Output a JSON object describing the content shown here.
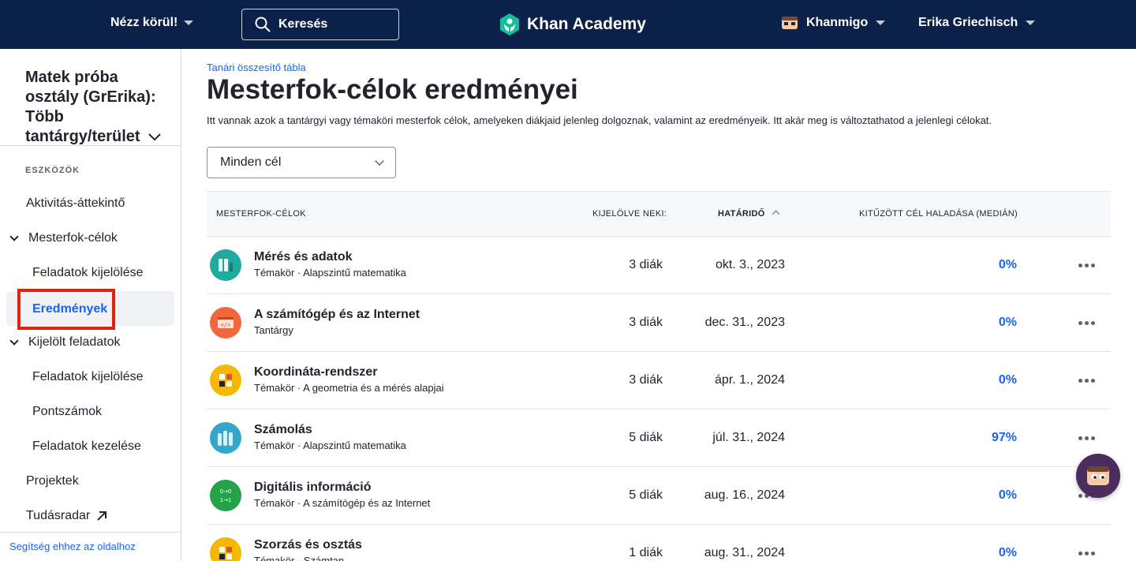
{
  "header": {
    "explore_label": "Nézz körül!",
    "search_placeholder": "Keresés",
    "logo_text": "Khan Academy",
    "khanmigo_label": "Khanmigo",
    "user_name": "Erika Griechisch",
    "brand_color": "#0b2149",
    "logo_color": "#14bf96"
  },
  "sidebar": {
    "class_title": "Matek próba osztály (GrErika): Több tantárgy/terület",
    "section_label": "ESZKÖZÖK",
    "items": [
      {
        "label": "Aktivitás-áttekintő"
      },
      {
        "label": "Mesterfok-célok"
      },
      {
        "label": "Feladatok kijelölése"
      },
      {
        "label": "Eredmények"
      },
      {
        "label": "Kijelölt feladatok"
      },
      {
        "label": "Feladatok kijelölése"
      },
      {
        "label": "Pontszámok"
      },
      {
        "label": "Feladatok kezelése"
      },
      {
        "label": "Projektek"
      },
      {
        "label": "Tudásradar"
      }
    ],
    "help_link": "Segítség ehhez az oldalhoz"
  },
  "main": {
    "breadcrumb": "Tanári összesítő tábla",
    "title": "Mesterfok-célok eredményei",
    "description": "Itt vannak azok a tantárgyi vagy témaköri mesterfok célok, amelyeken diákjaid jelenleg dolgoznak, valamint az eredményeik. Itt akár meg is változtathatod a jelenlegi célokat.",
    "filter_selected": "Minden cél",
    "columns": {
      "goals": "MESTERFOK-CÉLOK",
      "assigned": "KIJELÖLVE NEKI:",
      "due": "HATÁRIDŐ",
      "progress": "KITŰZÖTT CÉL HALADÁSA (MEDIÁN)"
    },
    "rows": [
      {
        "name": "Mérés és adatok",
        "sub": "Témakör · Alapszintű matematika",
        "students": "3 diák",
        "due": "okt. 3., 2023",
        "progress": "0%",
        "icon": "bar-chart-icon",
        "color": "#1fab9f"
      },
      {
        "name": "A számítógép és az Internet",
        "sub": "Tantárgy",
        "students": "3 diák",
        "due": "dec. 31., 2023",
        "progress": "0%",
        "icon": "code-window-icon",
        "color": "#f0683c"
      },
      {
        "name": "Koordináta-rendszer",
        "sub": "Témakör · A geometria és a mérés alapjai",
        "students": "3 diák",
        "due": "ápr. 1., 2024",
        "progress": "0%",
        "icon": "calculator-icon",
        "color": "#f5b800"
      },
      {
        "name": "Számolás",
        "sub": "Témakör · Alapszintű matematika",
        "students": "5 diák",
        "due": "júl. 31., 2024",
        "progress": "97%",
        "icon": "hands-icon",
        "color": "#33a7c9"
      },
      {
        "name": "Digitális információ",
        "sub": "Témakör · A számítógép és az Internet",
        "students": "5 diák",
        "due": "aug. 16., 2024",
        "progress": "0%",
        "icon": "binary-icon",
        "color": "#22a34a"
      },
      {
        "name": "Szorzás és osztás",
        "sub": "Témakör · Számtan",
        "students": "1 diák",
        "due": "aug. 31., 2024",
        "progress": "0%",
        "icon": "calculator-icon",
        "color": "#f5b800"
      }
    ]
  }
}
